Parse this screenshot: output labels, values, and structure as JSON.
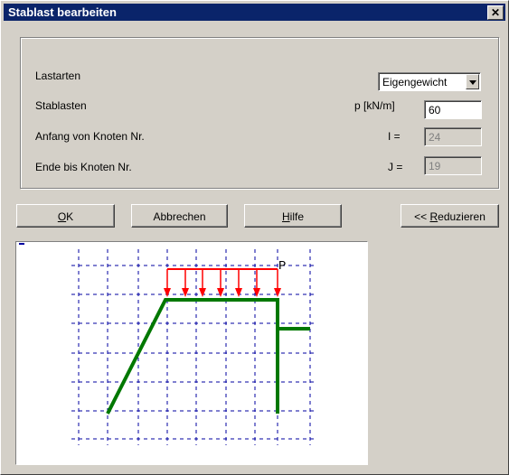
{
  "window": {
    "title": "Stablast bearbeiten",
    "close_glyph": "✕"
  },
  "form": {
    "lastarten_label": "Lastarten",
    "lastarten_value": "Eigengewicht",
    "stablasten_label": "Stablasten",
    "p_label": "p [kN/m]",
    "p_value": "60",
    "anfang_label": "Anfang von Knoten Nr.",
    "i_label": "I =",
    "i_value": "24",
    "ende_label": "Ende bis Knoten Nr.",
    "j_label": "J =",
    "j_value": "19"
  },
  "buttons": {
    "ok_mnemonic": "O",
    "ok_rest": "K",
    "abbrechen": "Abbrechen",
    "hilfe_mnemonic": "H",
    "hilfe_rest": "ilfe",
    "reduzieren_prefix": "<< ",
    "reduzieren_mnemonic": "R",
    "reduzieren_rest": "eduzieren"
  },
  "diagram": {
    "load_label": "P",
    "grid_color": "#0000a0",
    "load_color": "#ff0000",
    "member_color": "#007800"
  }
}
